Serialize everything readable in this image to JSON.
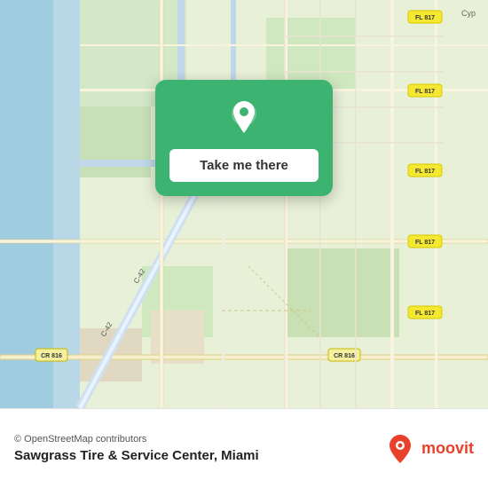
{
  "map": {
    "attribution": "© OpenStreetMap contributors",
    "background_color": "#e8f0d8"
  },
  "card": {
    "button_label": "Take me there",
    "pin_color": "#ffffff",
    "card_color": "#3cb371"
  },
  "bottom_bar": {
    "place_name": "Sawgrass Tire & Service Center, Miami",
    "attribution": "© OpenStreetMap contributors",
    "moovit_label": "moovit"
  }
}
